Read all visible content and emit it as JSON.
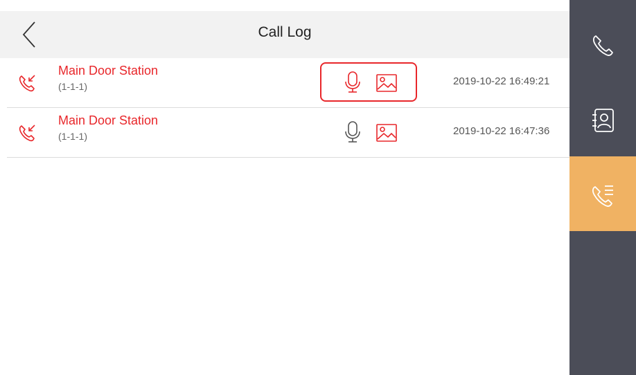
{
  "header": {
    "title": "Call Log",
    "back_icon": "chevron-left-icon"
  },
  "calls": [
    {
      "name": "Main Door Station",
      "number": "(1-1-1)",
      "timestamp": "2019-10-22 16:49:21",
      "direction_icon": "incoming-call-icon",
      "has_audio": true,
      "has_snapshot": true,
      "highlighted": true,
      "media_color": "#e8262a"
    },
    {
      "name": "Main Door Station",
      "number": "(1-1-1)",
      "timestamp": "2019-10-22 16:47:36",
      "direction_icon": "incoming-call-icon",
      "has_audio": true,
      "has_snapshot": true,
      "highlighted": false,
      "media_color": "#555555"
    }
  ],
  "sidebar": {
    "items": [
      {
        "icon": "phone-icon",
        "active": false
      },
      {
        "icon": "contacts-icon",
        "active": false
      },
      {
        "icon": "call-log-icon",
        "active": true
      }
    ]
  },
  "colors": {
    "accent_red": "#e8262a",
    "sidebar_bg": "#4b4d58",
    "sidebar_active": "#f0b263",
    "header_bg": "#f2f2f2"
  }
}
